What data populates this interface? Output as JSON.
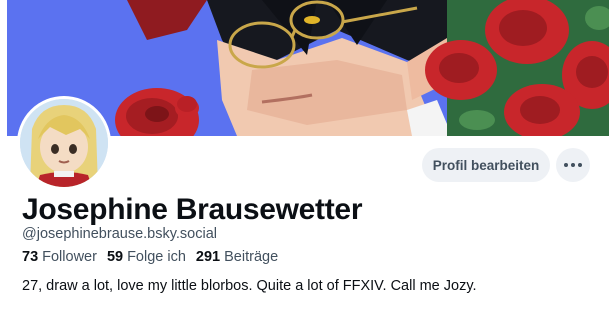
{
  "profile": {
    "display_name": "Josephine Brausewetter",
    "handle": "@josephinebrause.bsky.social",
    "bio": "27, draw a lot, love my little blorbos. Quite a lot of FFXIV. Call me Jozy.",
    "stats": {
      "followers_count": "73",
      "followers_label": "Follower",
      "following_count": "59",
      "following_label": "Folge ich",
      "posts_count": "291",
      "posts_label": "Beiträge"
    }
  },
  "actions": {
    "edit_label": "Profil bearbeiten",
    "more_icon": "ellipsis-horizontal-icon"
  },
  "images": {
    "banner": "illustration-man-with-glasses-and-red-roses",
    "avatar": "illustration-blonde-girl-avatar"
  },
  "colors": {
    "banner_background": "#5b72f0",
    "button_background": "#eef1f5",
    "text_primary": "#0b0f14",
    "text_secondary": "#42505e",
    "rose_red": "#c8262b"
  }
}
